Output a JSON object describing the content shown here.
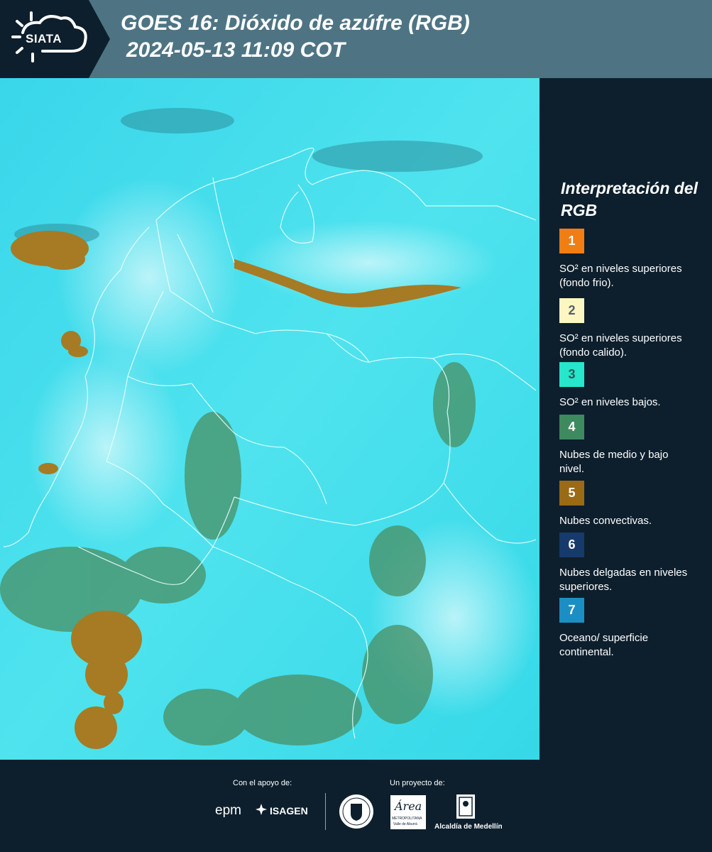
{
  "header": {
    "brand": "SIATA",
    "title_line1": "GOES 16: Dióxido de azúfre (RGB)",
    "title_line2": "2024-05-13 11:09 COT"
  },
  "legend": {
    "title": "Interpretación del RGB",
    "items": [
      {
        "num": "1",
        "label": "SO² en niveles superiores (fondo frio).",
        "color": "#f07e12",
        "num_color": "#ffffff"
      },
      {
        "num": "2",
        "label": "SO² en niveles superiores (fondo calido).",
        "color": "#fdf6c2",
        "num_color": "#556066"
      },
      {
        "num": "3",
        "label": "SO² en niveles bajos.",
        "color": "#26e6cc",
        "num_color": "#2b5a5a"
      },
      {
        "num": "4",
        "label": "Nubes de medio y bajo nivel.",
        "color": "#3d8a5e",
        "num_color": "#ffffff"
      },
      {
        "num": "5",
        "label": "Nubes convectivas.",
        "color": "#9a6b14",
        "num_color": "#ffffff"
      },
      {
        "num": "6",
        "label": "Nubes delgadas en niveles superiores.",
        "color": "#163a6b",
        "num_color": "#ffffff"
      },
      {
        "num": "7",
        "label": "Oceano/ superficie continental.",
        "color": "#1b8fc4",
        "num_color": "#ffffff"
      }
    ]
  },
  "footer": {
    "support_label": "Con el apoyo de:",
    "project_label": "Un proyecto de:",
    "epm": "epm",
    "isagen": "ISAGEN",
    "area_word": "Área",
    "area_sub1": "METROPOLITANA",
    "area_sub2": "Valle de Aburrá",
    "alcaldia": "Alcaldía de Medellín"
  },
  "colors": {
    "header_bg": "#4e7484",
    "logo_bg": "#0d1f2d",
    "sidebar_bg": "#0d1f2d",
    "map_base": "#2fd8e6"
  }
}
